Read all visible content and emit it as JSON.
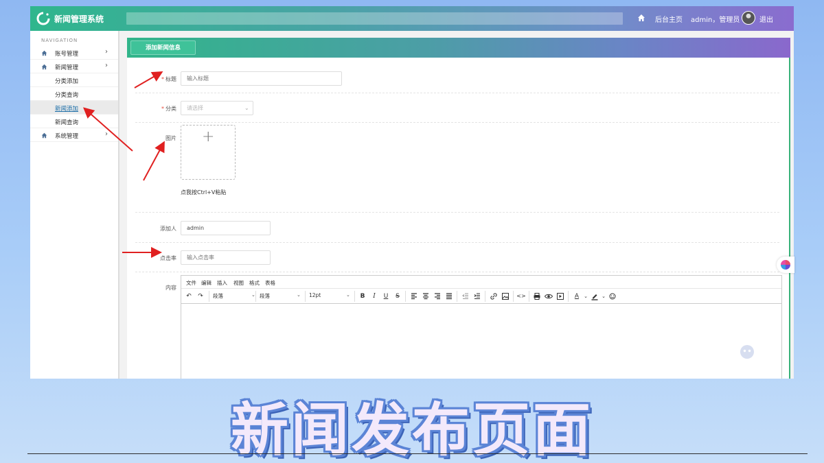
{
  "app": {
    "title": "新闻管理系统",
    "header_links": {
      "home": "后台主页",
      "user": "admin，管理员",
      "logout": "退出"
    }
  },
  "sidebar": {
    "heading": "NAVIGATION",
    "items": [
      {
        "label": "账号管理",
        "icon": "home-icon",
        "chevron": "›"
      },
      {
        "label": "新闻管理",
        "icon": "home-icon",
        "chevron": "›"
      },
      {
        "label": "系统管理",
        "icon": "home-icon",
        "chevron": "›"
      }
    ],
    "sub_items": [
      {
        "label": "分类添加",
        "active": false
      },
      {
        "label": "分类查询",
        "active": false
      },
      {
        "label": "新闻添加",
        "active": true
      },
      {
        "label": "新闻查询",
        "active": false
      }
    ]
  },
  "panel": {
    "tab_label": "添加新闻信息",
    "fields": {
      "title": {
        "label": "标题",
        "required_mark": "*",
        "placeholder": "输入标题",
        "value": ""
      },
      "category": {
        "label": "分类",
        "required_mark": "*",
        "placeholder": "请选择",
        "value": ""
      },
      "image": {
        "label": "图片",
        "plus": "+",
        "hint": "点我按Ctrl+V粘贴"
      },
      "author": {
        "label": "添加人",
        "value": "admin"
      },
      "clicks": {
        "label": "点击率",
        "placeholder": "输入点击率",
        "value": ""
      },
      "content": {
        "label": "内容"
      }
    },
    "editor": {
      "menu": [
        "文件",
        "编辑",
        "插入",
        "视图",
        "格式",
        "表格"
      ],
      "selects": {
        "block1": "段落",
        "block2": "段落",
        "font_size": "12pt"
      },
      "buttons": {
        "undo": "↶",
        "redo": "↷",
        "bold": "B",
        "italic": "I",
        "underline": "U",
        "strike": "S",
        "code": "<>",
        "link": "🔗",
        "image": "▣",
        "print": "⎙",
        "preview": "◉",
        "media": "▶",
        "font_color": "A",
        "emoji": "☺"
      }
    }
  },
  "caption": "新闻发布页面",
  "colors": {
    "accent_green": "#2fb68d",
    "accent_purple": "#8a6ccf",
    "arrow_red": "#e02020",
    "caption_fill": "#f3e9fb",
    "caption_stroke": "#5b84d6"
  }
}
